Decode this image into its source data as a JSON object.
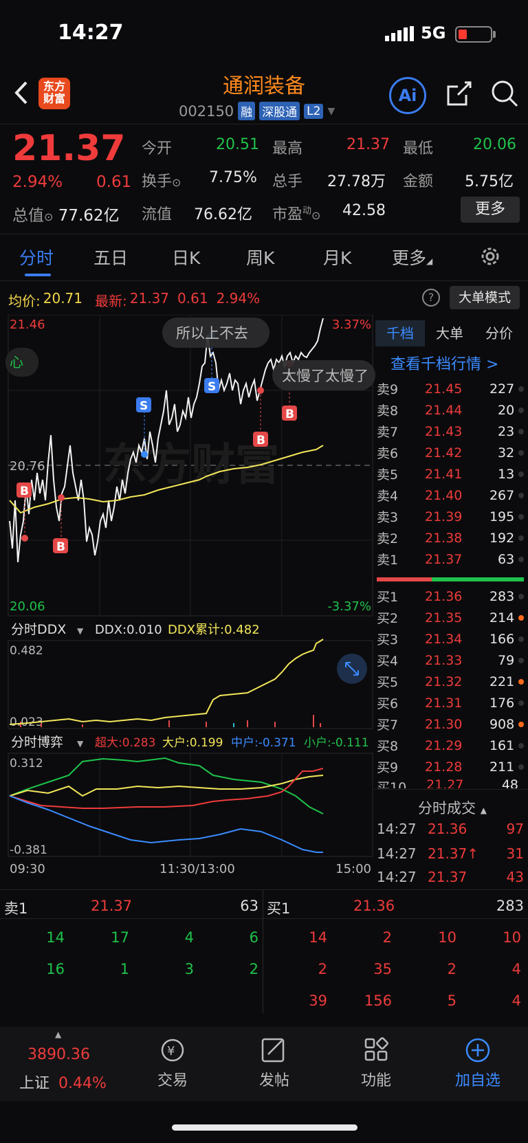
{
  "status_bar": {
    "time": "14:27",
    "network": "5G"
  },
  "header": {
    "logo_line1": "东方",
    "logo_line2": "财富",
    "stock_name": "通润装备",
    "stock_code": "002150",
    "tags": [
      "融",
      "深股通",
      "L2"
    ],
    "ai_label": "Ai"
  },
  "quote": {
    "price": "21.37",
    "change_pct": "2.94%",
    "change": "0.61",
    "total_mv_label": "总值",
    "total_mv": "77.62亿",
    "fields": [
      {
        "k": "今开",
        "v": "20.51",
        "c": "green"
      },
      {
        "k": "最高",
        "v": "21.37",
        "c": "red"
      },
      {
        "k": "最低",
        "v": "20.06",
        "c": "green"
      },
      {
        "k": "换手",
        "v": "7.75%",
        "c": "white"
      },
      {
        "k": "总手",
        "v": "27.78万",
        "c": "white"
      },
      {
        "k": "金额",
        "v": "5.75亿",
        "c": "white"
      },
      {
        "k": "流值",
        "v": "76.62亿",
        "c": "white"
      },
      {
        "k": "市盈",
        "v": "42.58",
        "c": "white",
        "sup": "动"
      }
    ],
    "more_label": "更多"
  },
  "tabs": [
    "分时",
    "五日",
    "日K",
    "周K",
    "月K",
    "更多"
  ],
  "chart_info": {
    "avg_label": "均价:",
    "avg": "20.71",
    "latest_label": "最新:",
    "latest": "21.37",
    "chg": "0.61",
    "pct": "2.94%",
    "help": "?",
    "bigorder_btn": "大单模式"
  },
  "chart_labels": {
    "y_top": "21.46",
    "y_mid": "20.76",
    "y_bottom": "20.06",
    "pct_top": "3.37%",
    "pct_bottom": "-3.37%",
    "left_tag": "心",
    "bubble1": "所以上不去",
    "bubble2": "太慢了太慢了",
    "ddx_title": "分时DDX",
    "ddx_val": "DDX:0.010",
    "ddx_cum": "DDX累计:0.482",
    "ddx_top": "0.482",
    "ddx_bottom": "0.023",
    "game_title": "分时博弈",
    "game_super": "超大:0.283",
    "game_big": "大户:0.199",
    "game_mid": "中户:-0.371",
    "game_small": "小户:-0.111",
    "game_top": "0.312",
    "game_bottom": "-0.381",
    "t_start": "09:30",
    "t_mid": "11:30/13:00",
    "t_end": "15:00",
    "mark_b": "B",
    "mark_s": "S"
  },
  "chart_data": {
    "type": "line",
    "title": "分时",
    "ylim": [
      20.06,
      21.46
    ],
    "series": [
      {
        "name": "均价",
        "color": "#f3e65a",
        "values": [
          20.6,
          20.5,
          20.52,
          20.55,
          20.57,
          20.6,
          20.62,
          20.65,
          20.68,
          20.7,
          20.71
        ]
      }
    ]
  },
  "orderbook": {
    "tabs": [
      "千档",
      "大单",
      "分价"
    ],
    "link": "查看千档行情 >",
    "asks": [
      {
        "l": "卖9",
        "p": "21.45",
        "v": "227"
      },
      {
        "l": "卖8",
        "p": "21.44",
        "v": "20"
      },
      {
        "l": "卖7",
        "p": "21.43",
        "v": "23"
      },
      {
        "l": "卖6",
        "p": "21.42",
        "v": "32"
      },
      {
        "l": "卖5",
        "p": "21.41",
        "v": "13"
      },
      {
        "l": "卖4",
        "p": "21.40",
        "v": "267"
      },
      {
        "l": "卖3",
        "p": "21.39",
        "v": "195"
      },
      {
        "l": "卖2",
        "p": "21.38",
        "v": "192"
      },
      {
        "l": "卖1",
        "p": "21.37",
        "v": "63"
      }
    ],
    "bids": [
      {
        "l": "买1",
        "p": "21.36",
        "v": "283",
        "dot": false
      },
      {
        "l": "买2",
        "p": "21.35",
        "v": "214",
        "dot": true
      },
      {
        "l": "买3",
        "p": "21.34",
        "v": "166",
        "dot": false
      },
      {
        "l": "买4",
        "p": "21.33",
        "v": "79",
        "dot": false
      },
      {
        "l": "买5",
        "p": "21.32",
        "v": "221",
        "dot": true
      },
      {
        "l": "买6",
        "p": "21.31",
        "v": "176",
        "dot": false
      },
      {
        "l": "买7",
        "p": "21.30",
        "v": "908",
        "dot": true
      },
      {
        "l": "买8",
        "p": "21.29",
        "v": "161",
        "dot": false
      },
      {
        "l": "买9",
        "p": "21.28",
        "v": "211",
        "dot": false
      },
      {
        "l": "买10",
        "p": "21.27",
        "v": "48",
        "dot": false
      }
    ],
    "ticks_title": "分时成交",
    "ticks": [
      {
        "t": "14:27",
        "p": "21.36",
        "v": "97"
      },
      {
        "t": "14:27",
        "p": "21.37↑",
        "v": "31"
      },
      {
        "t": "14:27",
        "p": "21.37",
        "v": "43"
      }
    ]
  },
  "queue": {
    "sell_label": "卖1",
    "sell_price": "21.37",
    "sell_vol": "63",
    "buy_label": "买1",
    "buy_price": "21.36",
    "buy_vol": "283",
    "sell_rows": [
      [
        "14",
        "17",
        "4",
        "6"
      ],
      [
        "16",
        "1",
        "3",
        "2"
      ]
    ],
    "buy_rows": [
      [
        "14",
        "2",
        "10",
        "10"
      ],
      [
        "2",
        "35",
        "2",
        "4"
      ],
      [
        "39",
        "156",
        "5",
        "4"
      ]
    ]
  },
  "nav": {
    "index_value": "3890.36",
    "index_name": "上证",
    "index_pct": "0.44%",
    "items": [
      "交易",
      "发帖",
      "功能",
      "加自选"
    ]
  }
}
